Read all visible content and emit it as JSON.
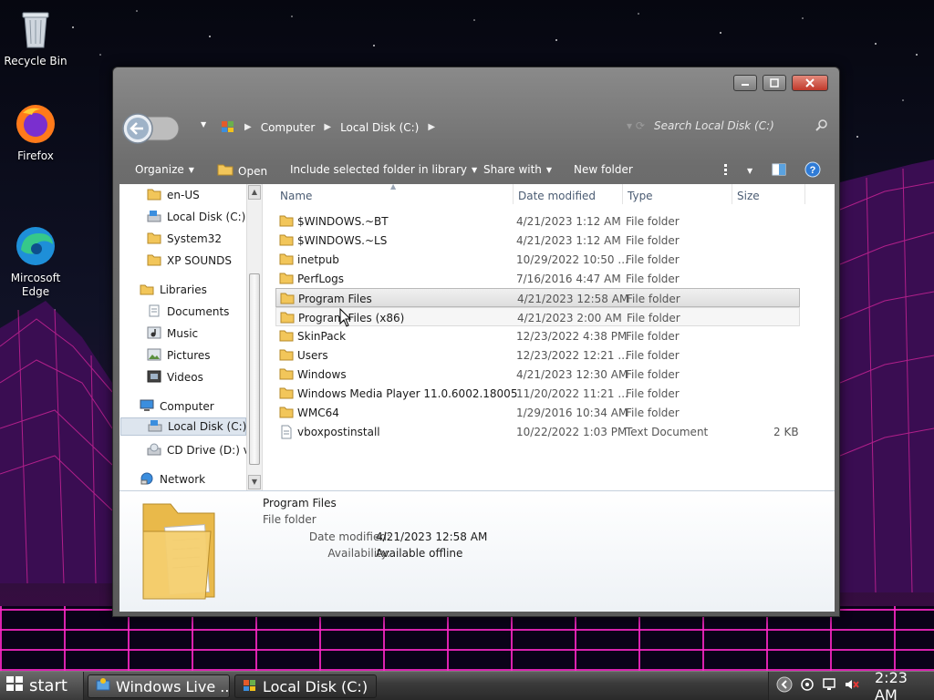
{
  "desktop": {
    "icons": [
      {
        "label": "Recycle Bin",
        "icon": "recycle-bin-icon"
      },
      {
        "label": "Firefox",
        "icon": "firefox-icon"
      },
      {
        "label": "Mircosoft\nEdge",
        "icon": "edge-icon"
      }
    ]
  },
  "window": {
    "breadcrumb": [
      "Computer",
      "Local Disk (C:)"
    ],
    "search_placeholder": "Search Local Disk (C:)",
    "toolbar": {
      "organize": "Organize",
      "open": "Open",
      "include": "Include selected folder in library",
      "share": "Share with",
      "new_folder": "New folder"
    },
    "nav": {
      "items": [
        {
          "label": "en-US",
          "icon": "folder-icon"
        },
        {
          "label": "Local Disk (C:)",
          "icon": "drive-icon"
        },
        {
          "label": "System32",
          "icon": "folder-icon"
        },
        {
          "label": "XP SOUNDS",
          "icon": "folder-icon"
        },
        {
          "label": "Libraries",
          "icon": "library-icon"
        },
        {
          "label": "Documents",
          "icon": "documents-icon"
        },
        {
          "label": "Music",
          "icon": "music-icon"
        },
        {
          "label": "Pictures",
          "icon": "pictures-icon"
        },
        {
          "label": "Videos",
          "icon": "videos-icon"
        },
        {
          "label": "Computer",
          "icon": "computer-icon"
        },
        {
          "label": "Local Disk (C:)",
          "icon": "drive-icon"
        },
        {
          "label": "CD Drive (D:) virt",
          "icon": "cd-drive-icon"
        },
        {
          "label": "Network",
          "icon": "network-icon"
        }
      ]
    },
    "columns": {
      "name": "Name",
      "date": "Date modified",
      "type": "Type",
      "size": "Size"
    },
    "files": [
      {
        "name": "$WINDOWS.~BT",
        "date": "4/21/2023 1:12 AM",
        "type": "File folder",
        "size": ""
      },
      {
        "name": "$WINDOWS.~LS",
        "date": "4/21/2023 1:12 AM",
        "type": "File folder",
        "size": ""
      },
      {
        "name": "inetpub",
        "date": "10/29/2022 10:50 ...",
        "type": "File folder",
        "size": ""
      },
      {
        "name": "PerfLogs",
        "date": "7/16/2016 4:47 AM",
        "type": "File folder",
        "size": ""
      },
      {
        "name": "Program Files",
        "date": "4/21/2023 12:58 AM",
        "type": "File folder",
        "size": ""
      },
      {
        "name": "Program Files (x86)",
        "date": "4/21/2023 2:00 AM",
        "type": "File folder",
        "size": ""
      },
      {
        "name": "SkinPack",
        "date": "12/23/2022 4:38 PM",
        "type": "File folder",
        "size": ""
      },
      {
        "name": "Users",
        "date": "12/23/2022 12:21 ...",
        "type": "File folder",
        "size": ""
      },
      {
        "name": "Windows",
        "date": "4/21/2023 12:30 AM",
        "type": "File folder",
        "size": ""
      },
      {
        "name": "Windows Media Player 11.0.6002.18005",
        "date": "11/20/2022 11:21 ...",
        "type": "File folder",
        "size": ""
      },
      {
        "name": "WMC64",
        "date": "1/29/2016 10:34 AM",
        "type": "File folder",
        "size": ""
      },
      {
        "name": "vboxpostinstall",
        "date": "10/22/2022 1:03 PM",
        "type": "Text Document",
        "size": "2 KB"
      }
    ],
    "details": {
      "name": "Program Files",
      "type": "File folder",
      "date_label": "Date modified:",
      "date_value": "4/21/2023 12:58 AM",
      "avail_label": "Availability:",
      "avail_value": "Available offline"
    }
  },
  "taskbar": {
    "start": "start",
    "tasks": [
      "Windows Live ...",
      "Local Disk (C:)"
    ],
    "clock": "2:23 AM"
  },
  "colors": {
    "accent": "#4a88c7",
    "selection": "#dedede",
    "taskbar": "#3b3b3b",
    "grid": "#ff28c8"
  }
}
